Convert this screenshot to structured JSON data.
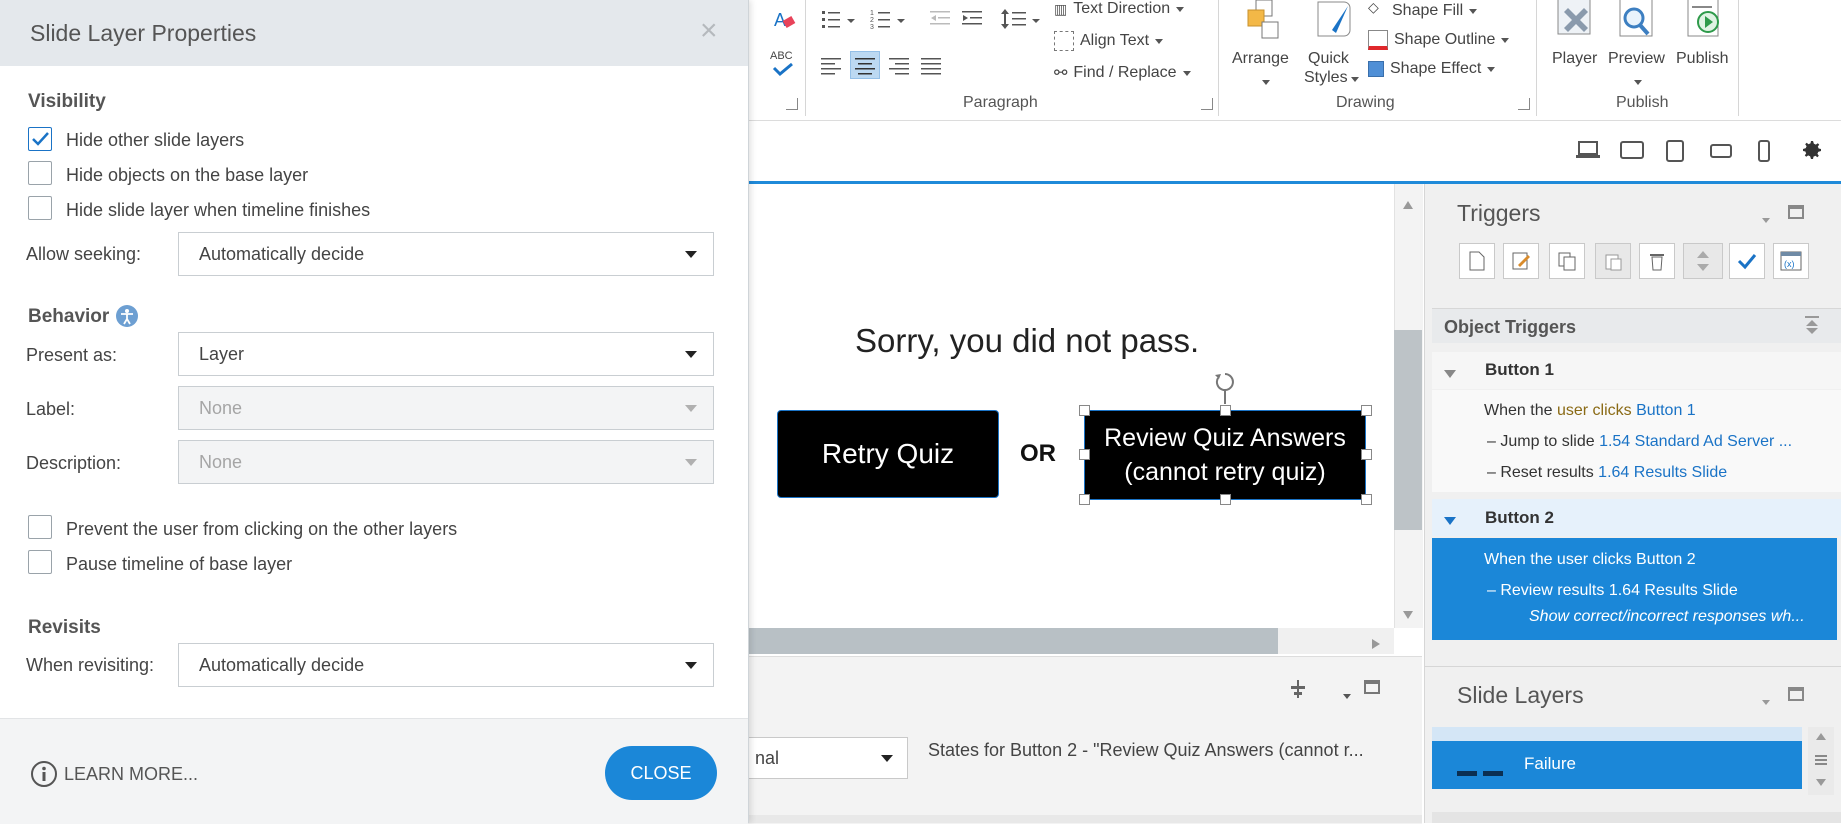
{
  "dialog": {
    "title": "Slide Layer Properties",
    "close_glyph": "×",
    "visibility": {
      "title": "Visibility",
      "hide_other_layers": "Hide other slide layers",
      "hide_base_objects": "Hide objects on the base layer",
      "hide_when_finishes": "Hide slide layer when timeline finishes",
      "allow_seeking_label": "Allow seeking:",
      "allow_seeking_value": "Automatically decide"
    },
    "behavior": {
      "title": "Behavior",
      "present_as_label": "Present as:",
      "present_as_value": "Layer",
      "label_label": "Label:",
      "label_value": "None",
      "description_label": "Description:",
      "description_value": "None",
      "prevent_clicking": "Prevent the user from clicking on the other layers",
      "pause_timeline": "Pause timeline of base layer"
    },
    "revisits": {
      "title": "Revisits",
      "when_label": "When revisiting:",
      "when_value": "Automatically decide"
    },
    "learn_more": "LEARN MORE...",
    "close_button": "CLOSE"
  },
  "ribbon": {
    "text_direction": "Text Direction",
    "align_text": "Align Text",
    "find_replace": "Find / Replace",
    "paragraph_group": "Paragraph",
    "arrange": "Arrange",
    "quick_styles_1": "Quick",
    "quick_styles_2": "Styles",
    "shape_fill": "Shape Fill",
    "shape_outline": "Shape Outline",
    "shape_effect": "Shape Effect",
    "drawing_group": "Drawing",
    "player": "Player",
    "preview": "Preview",
    "publish": "Publish",
    "publish_group": "Publish",
    "abc": "ABC"
  },
  "canvas": {
    "message": "Sorry, you did not pass.",
    "retry": "Retry Quiz",
    "or": "OR",
    "review_line1": "Review Quiz Answers",
    "review_line2": "(cannot retry quiz)"
  },
  "bottom": {
    "state_select": "nal",
    "states_for": "States for Button 2 - \"Review Quiz Answers  (cannot r..."
  },
  "triggers": {
    "title": "Triggers",
    "object_triggers": "Object Triggers",
    "button1": {
      "name": "Button 1",
      "when_prefix": "When the",
      "when_user": "user",
      "when_clicks": "clicks",
      "when_target": "Button 1",
      "jump_prefix": "Jump to slide",
      "jump_target": "1.54 Standard Ad Server ...",
      "reset_prefix": "Reset results",
      "reset_target": "1.64 Results Slide"
    },
    "button2": {
      "name": "Button 2",
      "when": "When the user clicks Button 2",
      "review": "Review results 1.64 Results Slide",
      "show": "Show correct/incorrect responses wh..."
    }
  },
  "slide_layers": {
    "title": "Slide Layers",
    "failure": "Failure"
  },
  "colors": {
    "accent": "#1f8ad9",
    "selection": "#1b87d8",
    "link": "#1a73c6"
  }
}
